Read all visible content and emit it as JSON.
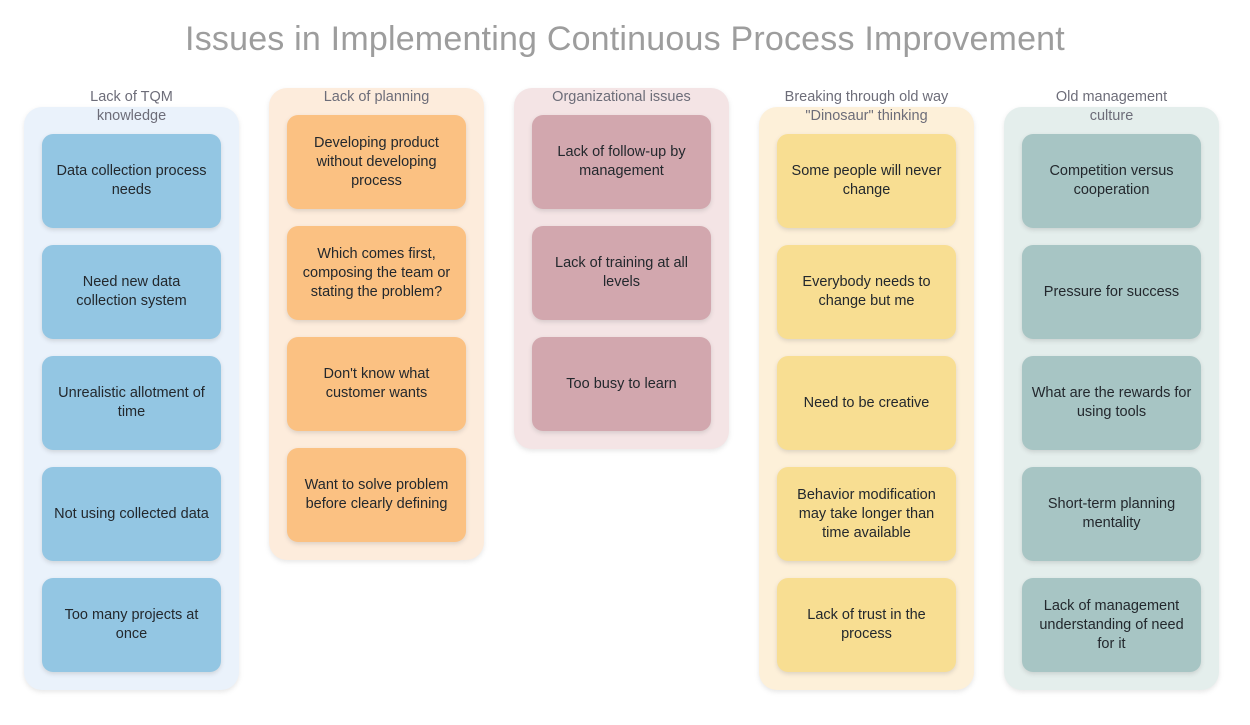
{
  "title": "Issues in Implementing Continuous Process Improvement",
  "diagram_type": "affinity-diagram",
  "columns": [
    {
      "id": "lack-of-tqm-knowledge",
      "header": "Lack of TQM\nknowledge",
      "container_color": "#eaf2fb",
      "card_color": "#93c6e3",
      "cards": [
        "Data collection process needs",
        "Need new data collection system",
        "Unrealistic allotment of time",
        "Not using collected data",
        "Too many projects at once"
      ]
    },
    {
      "id": "lack-of-planning",
      "header": "Lack of planning",
      "container_color": "#fdecdc",
      "card_color": "#fbc182",
      "cards": [
        "Developing product without developing process",
        "Which comes first, composing the team or stating the problem?",
        "Don't know what customer wants",
        "Want to solve problem before clearly defining"
      ]
    },
    {
      "id": "organizational-issues",
      "header": "Organizational issues",
      "container_color": "#f4e4e5",
      "card_color": "#d2a7ae",
      "cards": [
        "Lack of follow-up by management",
        "Lack of training at all levels",
        "Too busy to learn"
      ]
    },
    {
      "id": "breaking-through-old-way-dinosaur-thinking",
      "header": "Breaking through old way\n\"Dinosaur\" thinking",
      "container_color": "#fdf0d9",
      "card_color": "#f8de92",
      "cards": [
        "Some people will never change",
        "Everybody needs to change but me",
        "Need to be creative",
        "Behavior modification may take longer than time available",
        "Lack of trust in the process"
      ]
    },
    {
      "id": "old-management-culture",
      "header": "Old management\nculture",
      "container_color": "#e4eeec",
      "card_color": "#a7c5c4",
      "cards": [
        "Competition versus cooperation",
        "Pressure for success",
        "What are the rewards for using tools",
        "Short-term planning mentality",
        "Lack of management understanding of need for it"
      ]
    }
  ],
  "colors": {
    "title": "#9d9d9d",
    "header_text": "#6d6d79",
    "card_text": "#23282d",
    "background": "#ffffff"
  }
}
